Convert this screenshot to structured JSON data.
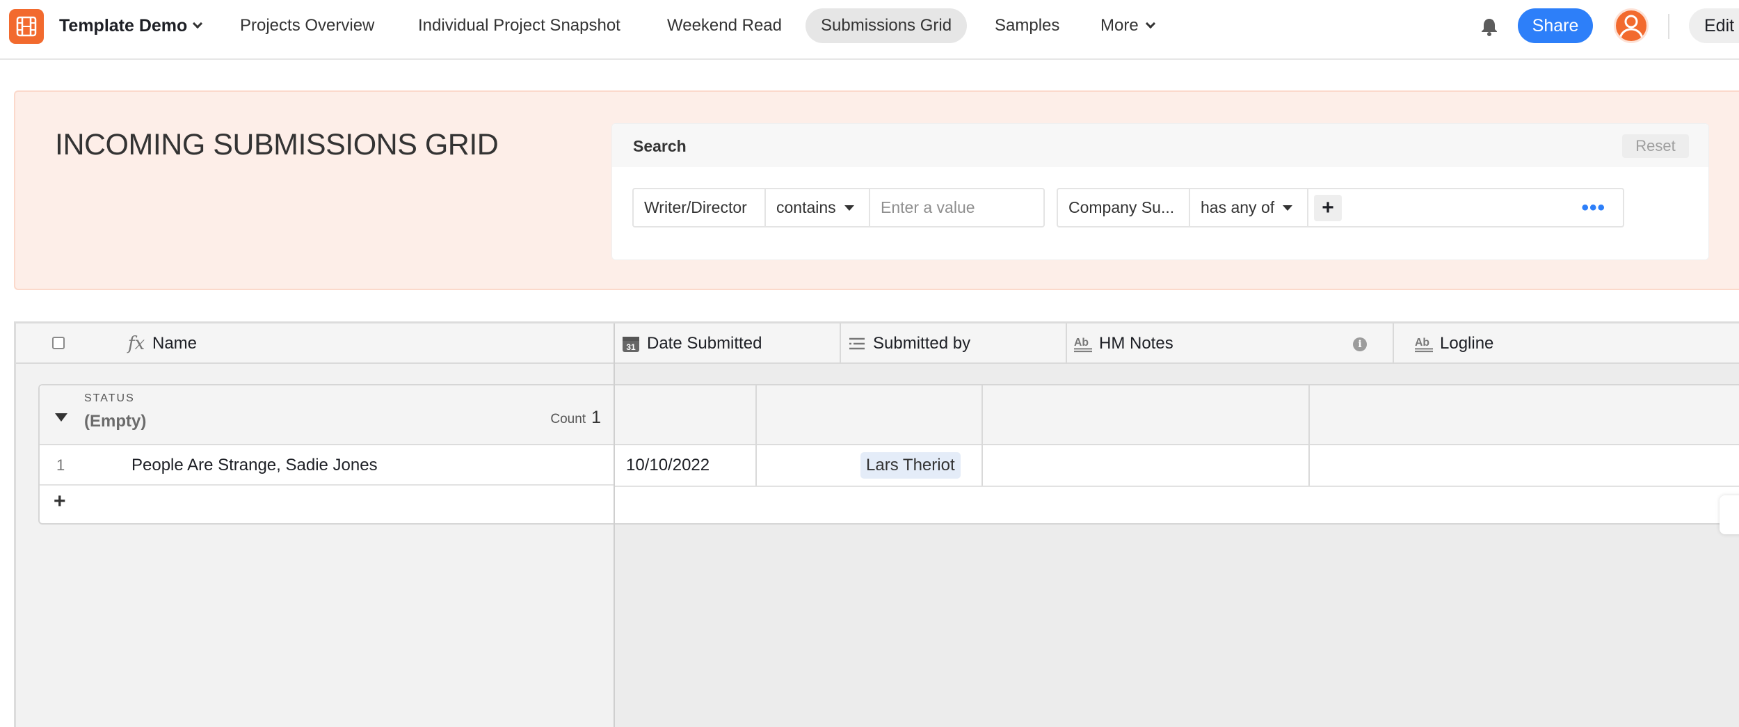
{
  "app": {
    "name": "Template Demo",
    "logo_icon": "film-icon",
    "brand_color": "#f26a2e"
  },
  "nav": {
    "tabs": [
      {
        "label": "Projects Overview"
      },
      {
        "label": "Individual Project Snapshot"
      },
      {
        "label": "Weekend Read"
      },
      {
        "label": "Submissions Grid",
        "active": true
      },
      {
        "label": "Samples"
      }
    ],
    "more_label": "More",
    "share_label": "Share",
    "edit_label": "Edit",
    "accent": "#2d7ff9"
  },
  "page": {
    "title": "INCOMING SUBMISSIONS GRID",
    "hero_bg": "#fdeee8"
  },
  "search": {
    "title": "Search",
    "reset_label": "Reset",
    "filters": [
      {
        "field": "Writer/Director",
        "operator": "contains",
        "placeholder": "Enter a value"
      },
      {
        "field": "Company Su...",
        "operator": "has any of"
      }
    ]
  },
  "grid": {
    "columns": [
      {
        "label": "Name",
        "icon": "formula-icon"
      },
      {
        "label": "Date Submitted",
        "icon": "calendar-icon"
      },
      {
        "label": "Submitted by",
        "icon": "lookup-icon"
      },
      {
        "label": "HM Notes",
        "icon": "long-text-icon"
      },
      {
        "label": "Logline",
        "icon": "long-text-icon"
      }
    ],
    "group": {
      "field_label": "STATUS",
      "value": "(Empty)",
      "count_label": "Count",
      "count": "1"
    },
    "rows": [
      {
        "num": "1",
        "name": "People Are Strange, Sadie Jones",
        "date_submitted": "10/10/2022",
        "submitted_by": "Lars Theriot"
      }
    ],
    "add_row_label": "+"
  }
}
